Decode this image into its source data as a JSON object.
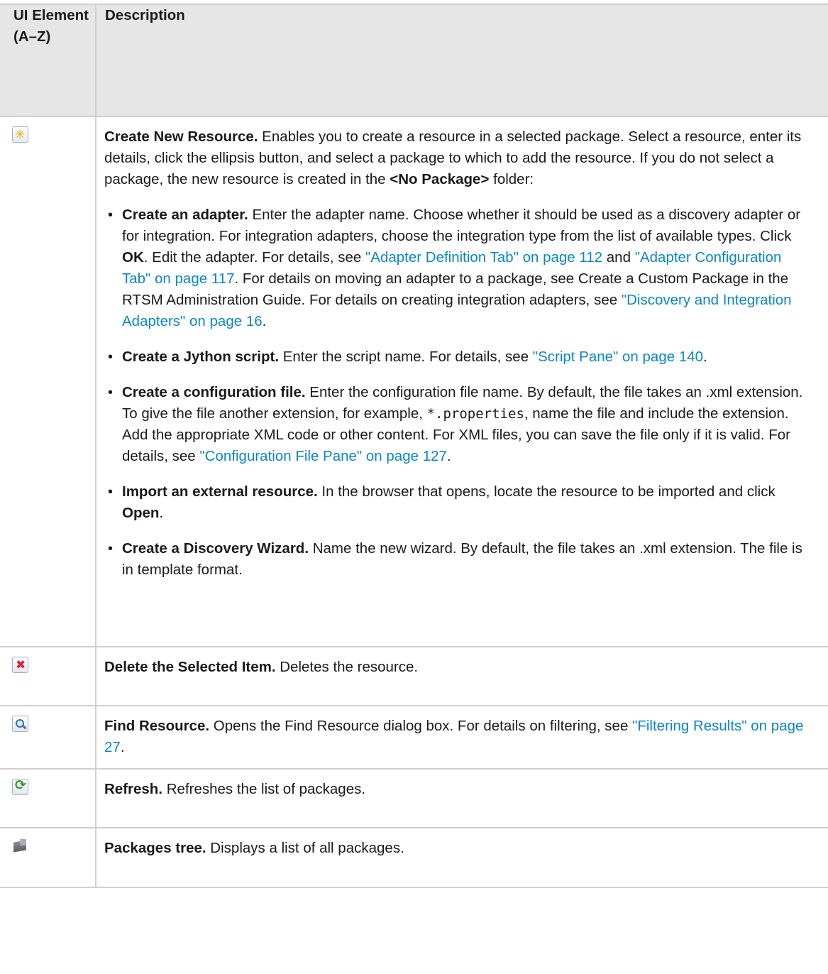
{
  "header": {
    "col1": "UI Element (A–Z)",
    "col2": "Description"
  },
  "rows": [
    {
      "icon": "create-new-resource-icon",
      "title": "Create New Resource.",
      "intro_a": " Enables you to create a resource in a selected package. Select a resource, enter its details, click the ellipsis  button, and select a package to which to add the resource. If you do not select a package, the new resource is created in the ",
      "intro_b": "<No Package>",
      "intro_c": " folder:",
      "bullets": [
        {
          "title": "Create an adapter.",
          "t1": " Enter the adapter name. Choose whether it should be used as a discovery adapter or for integration. For integration adapters, choose the integration type from the list of available types. Click ",
          "b2": "OK",
          "t2": ". Edit the adapter. For details, see ",
          "l1": "\"Adapter Definition Tab\" on page 112",
          "t3": " and ",
          "l2": "\"Adapter Configuration Tab\" on page 117",
          "t4": ". For details on moving an adapter to a package, see Create a Custom Package in the RTSM Administration Guide. For details on creating integration adapters, see ",
          "l3": "\"Discovery and Integration Adapters\" on page 16",
          "t5": "."
        },
        {
          "title": "Create a Jython script.",
          "t1": " Enter the script name. For details, see ",
          "l1": "\"Script Pane\" on page 140",
          "t2": "."
        },
        {
          "title": "Create a configuration file.",
          "t1": " Enter the configuration file name. By default, the file takes an .xml extension. To give the file another extension, for example, ",
          "code": "*.properties",
          "t2": ", name the file and include the extension. Add the appropriate XML code or other content. For XML files, you can save the file only if it is valid. For details, see ",
          "l1": "\"Configuration File Pane\" on page 127",
          "t3": "."
        },
        {
          "title": "Import an external resource.",
          "t1": " In the browser that opens, locate the resource to be imported and click ",
          "b2": "Open",
          "t2": "."
        },
        {
          "title": "Create a Discovery Wizard.",
          "t1": " Name the new wizard. By default, the file takes an .xml extension. The file is in template format."
        }
      ]
    },
    {
      "icon": "delete-icon",
      "title": "Delete the Selected Item.",
      "text": " Deletes the resource."
    },
    {
      "icon": "find-icon",
      "title": "Find Resource.",
      "text": " Opens the Find Resource dialog box. For details on filtering, see ",
      "link": "\"Filtering Results\" on page 27",
      "tail": "."
    },
    {
      "icon": "refresh-icon",
      "lead": " ",
      "title": "Refresh.",
      "text": " Refreshes the list of packages."
    },
    {
      "icon": "packages-tree-icon",
      "title": "Packages tree.",
      "text": " Displays a list of all packages."
    }
  ]
}
